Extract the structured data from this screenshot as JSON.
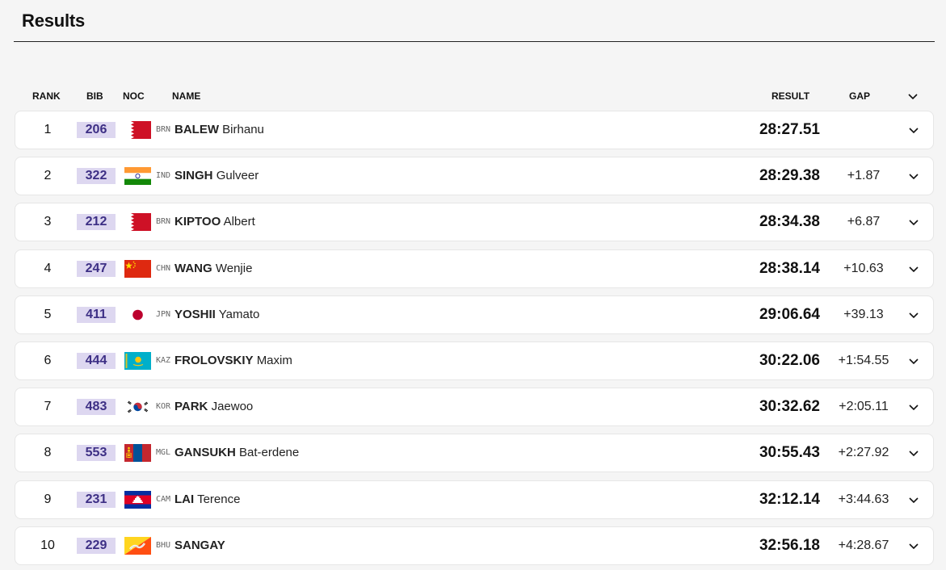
{
  "title": "Results",
  "headers": {
    "rank": "RANK",
    "bib": "BIB",
    "noc": "NOC",
    "name": "NAME",
    "result": "RESULT",
    "gap": "GAP"
  },
  "icons": {
    "header_toggle": "chevron-down-icon",
    "row_expand": "chevron-down-icon"
  },
  "colors": {
    "bib_background": "#ddd7f0",
    "bib_text": "#3d2f85",
    "row_background": "#ffffff",
    "page_background": "#f5f5f5"
  },
  "rows": [
    {
      "rank": "1",
      "bib": "206",
      "noc": "BRN",
      "last": "BALEW",
      "first": "Birhanu",
      "result": "28:27.51",
      "gap": ""
    },
    {
      "rank": "2",
      "bib": "322",
      "noc": "IND",
      "last": "SINGH",
      "first": "Gulveer",
      "result": "28:29.38",
      "gap": "+1.87"
    },
    {
      "rank": "3",
      "bib": "212",
      "noc": "BRN",
      "last": "KIPTOO",
      "first": "Albert",
      "result": "28:34.38",
      "gap": "+6.87"
    },
    {
      "rank": "4",
      "bib": "247",
      "noc": "CHN",
      "last": "WANG",
      "first": "Wenjie",
      "result": "28:38.14",
      "gap": "+10.63"
    },
    {
      "rank": "5",
      "bib": "411",
      "noc": "JPN",
      "last": "YOSHII",
      "first": "Yamato",
      "result": "29:06.64",
      "gap": "+39.13"
    },
    {
      "rank": "6",
      "bib": "444",
      "noc": "KAZ",
      "last": "FROLOVSKIY",
      "first": "Maxim",
      "result": "30:22.06",
      "gap": "+1:54.55"
    },
    {
      "rank": "7",
      "bib": "483",
      "noc": "KOR",
      "last": "PARK",
      "first": "Jaewoo",
      "result": "30:32.62",
      "gap": "+2:05.11"
    },
    {
      "rank": "8",
      "bib": "553",
      "noc": "MGL",
      "last": "GANSUKH",
      "first": "Bat-erdene",
      "result": "30:55.43",
      "gap": "+2:27.92"
    },
    {
      "rank": "9",
      "bib": "231",
      "noc": "CAM",
      "last": "LAI",
      "first": "Terence",
      "result": "32:12.14",
      "gap": "+3:44.63"
    },
    {
      "rank": "10",
      "bib": "229",
      "noc": "BHU",
      "last": "SANGAY",
      "first": "",
      "result": "32:56.18",
      "gap": "+4:28.67"
    }
  ]
}
